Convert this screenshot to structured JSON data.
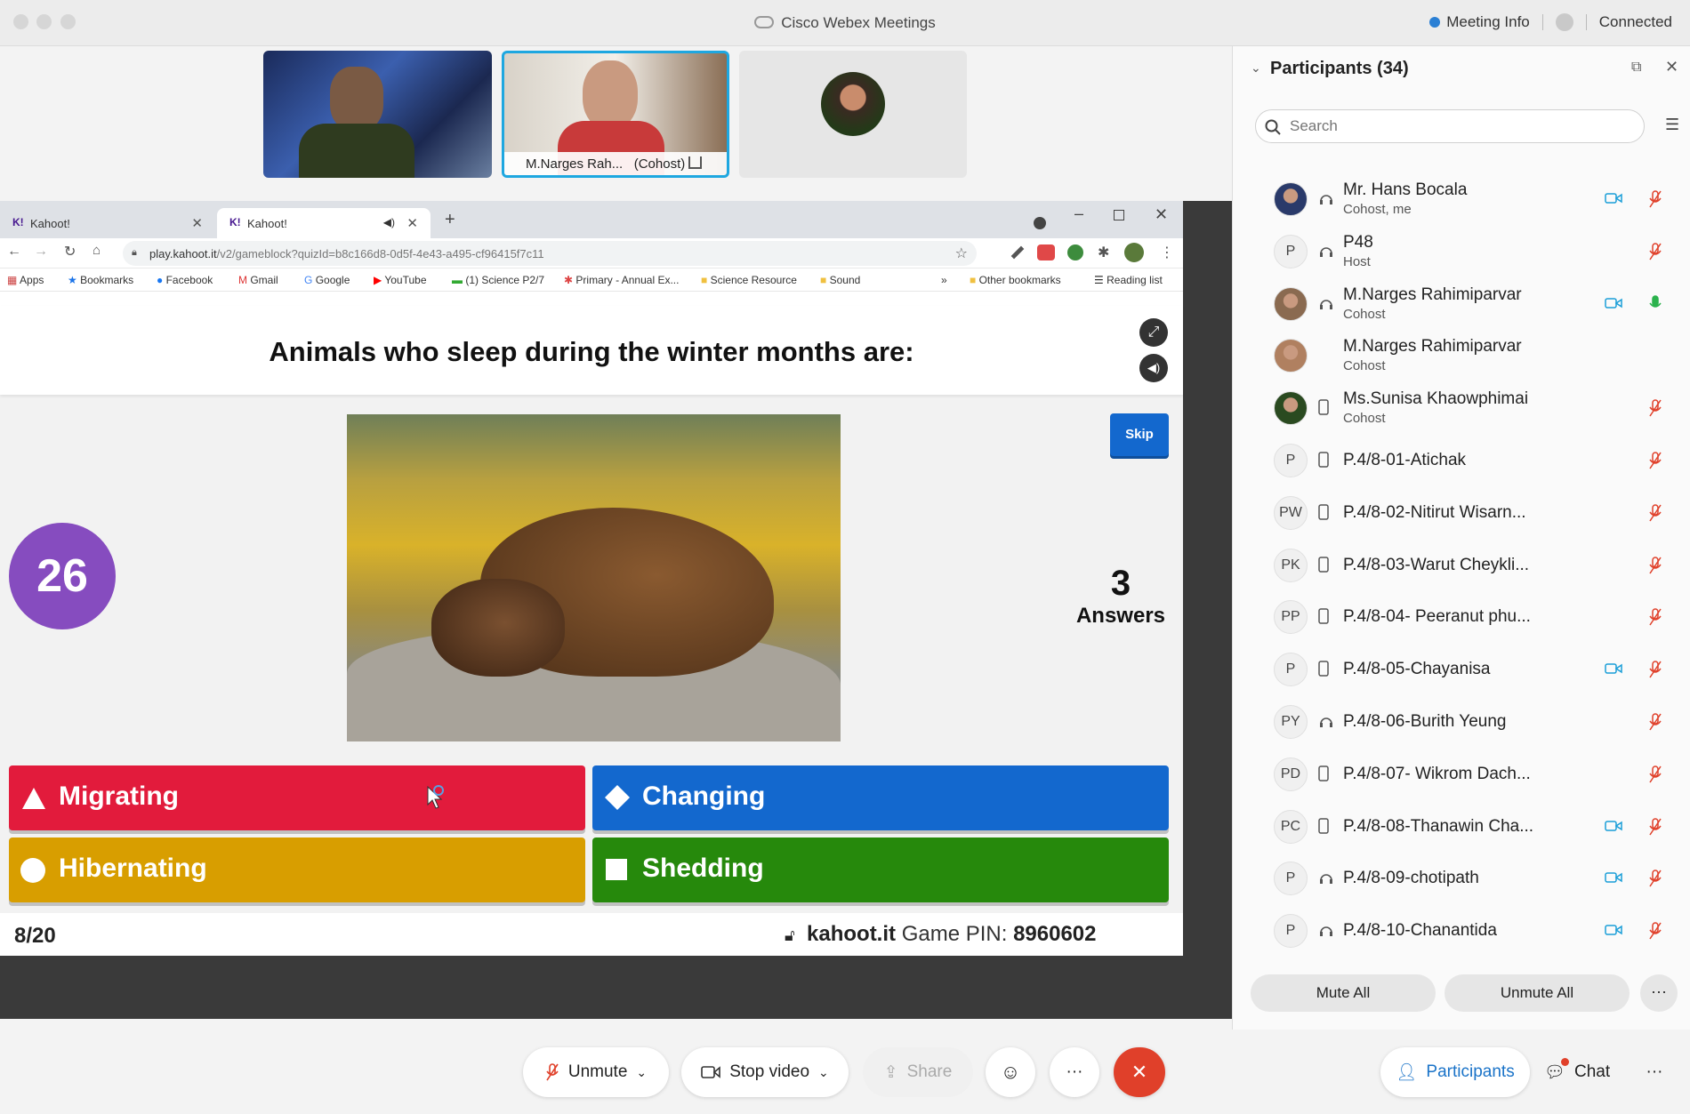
{
  "app": {
    "title": "Cisco Webex Meetings",
    "meeting_info": "Meeting Info",
    "status": "Connected"
  },
  "videos": {
    "active_name": "M.Narges Rah...",
    "active_role": "(Cohost)"
  },
  "browser": {
    "tabs": [
      {
        "label": "Kahoot!"
      },
      {
        "label": "Kahoot!"
      }
    ],
    "url_host": "play.kahoot.it",
    "url_path": "/v2/gameblock?quizId=b8c166d8-0d5f-4e43-a495-cf96415f7c11",
    "bookmarks": [
      "Apps",
      "Bookmarks",
      "Facebook",
      "Gmail",
      "Google",
      "YouTube",
      "(1) Science P2/7",
      "Primary - Annual Ex...",
      "Science Resource",
      "Sound",
      "»",
      "Other bookmarks",
      "Reading list"
    ]
  },
  "kahoot": {
    "question": "Animals who sleep during the winter months are:",
    "timer": "26",
    "answers_count": "3",
    "answers_label": "Answers",
    "skip": "Skip",
    "choices": [
      {
        "label": "Migrating",
        "color": "#e21b3c"
      },
      {
        "label": "Changing",
        "color": "#1368ce"
      },
      {
        "label": "Hibernating",
        "color": "#d89e00"
      },
      {
        "label": "Shedding",
        "color": "#26890c"
      }
    ],
    "progress": "8/20",
    "site": "kahoot.it",
    "pin_label": "Game PIN:",
    "pin": "8960602"
  },
  "panel": {
    "title": "Participants (34)",
    "search_placeholder": "Search",
    "participants": [
      {
        "name": "Mr. Hans Bocala",
        "role": "Cohost, me",
        "initials": "",
        "device": "headset",
        "video": true,
        "mic": "muted"
      },
      {
        "name": "P48",
        "role": "Host",
        "initials": "P",
        "device": "headset",
        "video": false,
        "mic": "muted"
      },
      {
        "name": "M.Narges Rahimiparvar",
        "role": "Cohost",
        "initials": "",
        "device": "headset",
        "video": true,
        "mic": "on"
      },
      {
        "name": "M.Narges Rahimiparvar",
        "role": "Cohost",
        "initials": "",
        "device": "",
        "video": false,
        "mic": ""
      },
      {
        "name": "Ms.Sunisa Khaowphimai",
        "role": "Cohost",
        "initials": "",
        "device": "phone",
        "video": false,
        "mic": "muted"
      },
      {
        "name": "P.4/8-01-Atichak",
        "role": "",
        "initials": "P",
        "device": "phone",
        "video": false,
        "mic": "muted"
      },
      {
        "name": "P.4/8-02-Nitirut Wisarn...",
        "role": "",
        "initials": "PW",
        "device": "phone",
        "video": false,
        "mic": "muted"
      },
      {
        "name": "P.4/8-03-Warut Cheykli...",
        "role": "",
        "initials": "PK",
        "device": "phone",
        "video": false,
        "mic": "muted"
      },
      {
        "name": "P.4/8-04- Peeranut phu...",
        "role": "",
        "initials": "PP",
        "device": "phone",
        "video": false,
        "mic": "muted"
      },
      {
        "name": "P.4/8-05-Chayanisa",
        "role": "",
        "initials": "P",
        "device": "phone",
        "video": true,
        "mic": "muted"
      },
      {
        "name": "P.4/8-06-Burith Yeung",
        "role": "",
        "initials": "PY",
        "device": "headset",
        "video": false,
        "mic": "muted"
      },
      {
        "name": "P.4/8-07- Wikrom Dach...",
        "role": "",
        "initials": "PD",
        "device": "phone",
        "video": false,
        "mic": "muted"
      },
      {
        "name": "P.4/8-08-Thanawin Cha...",
        "role": "",
        "initials": "PC",
        "device": "phone",
        "video": true,
        "mic": "muted"
      },
      {
        "name": "P.4/8-09-chotipath",
        "role": "",
        "initials": "P",
        "device": "headset",
        "video": true,
        "mic": "muted"
      },
      {
        "name": "P.4/8-10-Chanantida",
        "role": "",
        "initials": "P",
        "device": "headset",
        "video": true,
        "mic": "muted"
      }
    ],
    "mute_all": "Mute All",
    "unmute_all": "Unmute All"
  },
  "controls": {
    "unmute": "Unmute",
    "stop_video": "Stop video",
    "share": "Share",
    "participants": "Participants",
    "chat": "Chat"
  }
}
